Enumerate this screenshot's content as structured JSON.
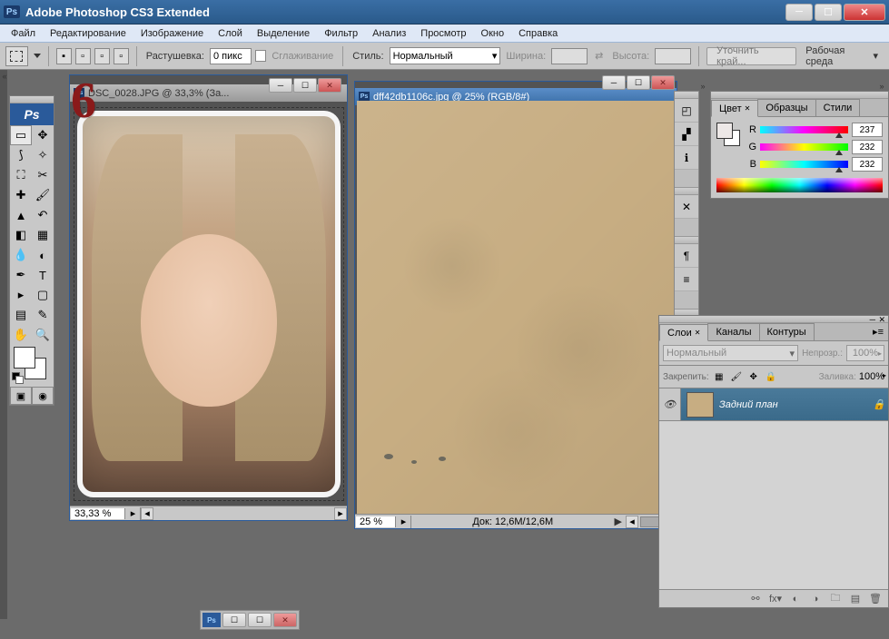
{
  "app": {
    "title": "Adobe Photoshop CS3 Extended",
    "logo": "Ps"
  },
  "menu": [
    "Файл",
    "Редактирование",
    "Изображение",
    "Слой",
    "Выделение",
    "Фильтр",
    "Анализ",
    "Просмотр",
    "Окно",
    "Справка"
  ],
  "options": {
    "feather_label": "Растушевка:",
    "feather_value": "0 пикс",
    "antialias_label": "Сглаживание",
    "style_label": "Стиль:",
    "style_value": "Нормальный",
    "width_label": "Ширина:",
    "height_label": "Высота:",
    "refine_btn": "Уточнить край...",
    "workspace_label": "Рабочая среда"
  },
  "documents": {
    "doc1": {
      "title": "DSC_0028.JPG @ 33,3% (За...",
      "zoom": "33,33 %"
    },
    "doc2": {
      "title": "dff42db1106c.jpg @ 25% (RGB/8#)",
      "zoom": "25 %",
      "status": "Док: 12,6M/12,6M"
    }
  },
  "annotation": {
    "six": "6"
  },
  "color_panel": {
    "tabs": [
      "Цвет",
      "Образцы",
      "Стили"
    ],
    "channels": {
      "R": "237",
      "G": "232",
      "B": "232"
    }
  },
  "layers_panel": {
    "tabs": [
      "Слои",
      "Каналы",
      "Контуры"
    ],
    "blend_mode": "Нормальный",
    "opacity_label": "Непрозр.:",
    "opacity_val": "100%",
    "lock_label": "Закрепить:",
    "fill_label": "Заливка:",
    "fill_val": "100%",
    "layer_name": "Задний план"
  }
}
